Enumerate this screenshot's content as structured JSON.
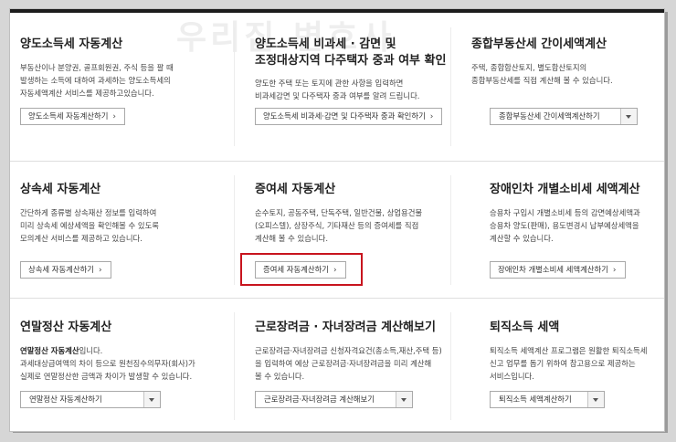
{
  "watermark": "우리집 변호사",
  "sections": [
    {
      "title": "양도소득세 자동계산",
      "desc": [
        "부동산이나 분양권, 골프회원권, 주식 등을 팔 때",
        "발생하는 소득에 대하여 과세하는 양도소득세의",
        "자동세액계산 서비스를 제공하고있습니다."
      ],
      "button": "양도소득세 자동계산하기"
    },
    {
      "title": [
        "양도소득세 비과세 · 감면 및",
        "조정대상지역 다주택자 중과 여부 확인"
      ],
      "desc": [
        "양도한 주택 또는 토지에 관한 사항을 입력하면",
        "비과세감면 및 다주택자 중과 여부를 알려 드립니다."
      ],
      "button": "양도소득세 비과세·감면 및 다주택자 중과 확인하기"
    },
    {
      "title": "종합부동산세 간이세액계산",
      "desc": [
        "주택, 종합합산토지, 별도합산토지의",
        "종합부동산세를 직접 계산해 볼 수 있습니다."
      ],
      "select": "종합부동산세 간이세액계산하기"
    },
    {
      "title": "상속세 자동계산",
      "desc": [
        "간단하게 종류별 상속재산 정보를 입력하여",
        "미리 상속세 예상세액을 확인해볼 수 있도록",
        "모의계산 서비스를 제공하고 있습니다."
      ],
      "button": "상속세 자동계산하기"
    },
    {
      "title": "증여세 자동계산",
      "desc": [
        "순수토지, 공동주택, 단독주택, 일반건물, 상업용건물",
        "(오피스텔), 상장주식, 기타재산 등의 증여세를 직접",
        "계산해 볼 수 있습니다."
      ],
      "button": "증여세 자동계산하기"
    },
    {
      "title": "장애인차 개별소비세 세액계산",
      "desc": [
        "승용차 구입시 개별소비세 등의 감면예상세액과",
        "승용차 양도(판매), 용도변경시 납부예상세액을",
        "계산할 수 있습니다."
      ],
      "button": "장애인차 개별소비세 세액계산하기"
    },
    {
      "title": "연말정산 자동계산",
      "desc_bold": "연말정산 자동계산",
      "desc_first_rest": "입니다.",
      "desc": [
        "과세대상급여액의 차이 등으로 원천징수의무자(회사)가",
        "실제로 연말정산한 금액과 차이가 발생할 수 있습니다."
      ],
      "select": "연말정산 자동계산하기"
    },
    {
      "title": "근로장려금 · 자녀장려금 계산해보기",
      "desc": [
        "근로장려금·자녀장려금 신청자격요건(총소득,재산,주택 등)",
        "을 입력하여 예상 근로장려금·자녀장려금을 미리 계산해",
        "볼 수 있습니다."
      ],
      "select": "근로장려금·자녀장려금 계산해보기"
    },
    {
      "title": "퇴직소득 세액",
      "desc": [
        "퇴직소득 세액계산 프로그램은 원활한 퇴직소득세",
        "신고 업무를 돕기 위하여 참고용으로 제공하는",
        "서비스입니다."
      ],
      "select": "퇴직소득 세액계산하기"
    }
  ],
  "arrow_glyph": "›"
}
